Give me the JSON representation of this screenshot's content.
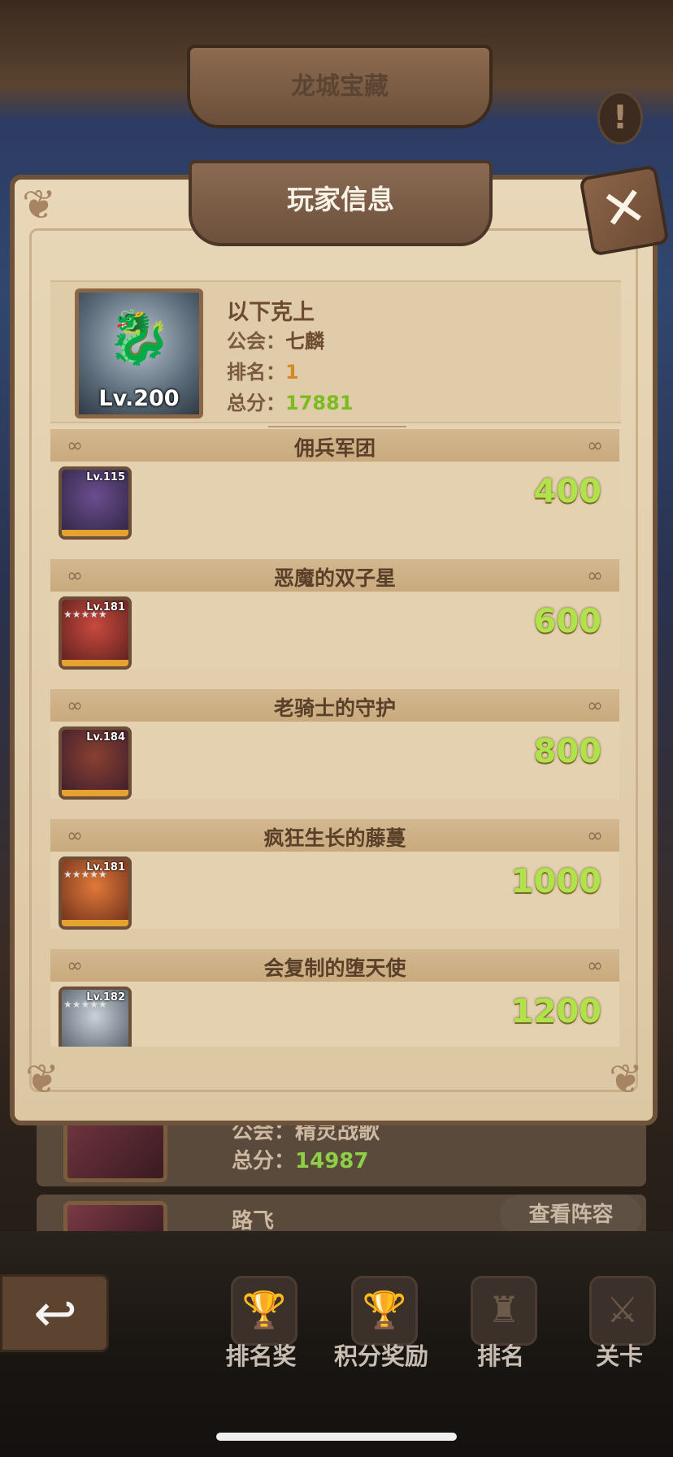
{
  "top_title": "龙城宝藏",
  "info_icon": "!",
  "modal": {
    "title": "玩家信息",
    "close_icon": "✕"
  },
  "player": {
    "level": "Lv.200",
    "name": "以下克上",
    "guild_label": "公会：",
    "guild_value": "七麟",
    "rank_label": "排名：",
    "rank_value": "1",
    "total_label": "总分：",
    "total_value": "17881"
  },
  "sections": [
    {
      "title": "佣兵军团",
      "hero_level": "Lv.115",
      "score": "400",
      "hero_colors": [
        "#6b4d8f",
        "#2d2540"
      ],
      "stars": ""
    },
    {
      "title": "恶魔的双子星",
      "hero_level": "Lv.181",
      "score": "600",
      "hero_colors": [
        "#c74a3d",
        "#5a1e1e"
      ],
      "stars": "★★★★★"
    },
    {
      "title": "老骑士的守护",
      "hero_level": "Lv.184",
      "score": "800",
      "hero_colors": [
        "#8a4030",
        "#3b1d2e"
      ],
      "stars": ""
    },
    {
      "title": "疯狂生长的藤蔓",
      "hero_level": "Lv.181",
      "score": "1000",
      "hero_colors": [
        "#e0793a",
        "#6a2d1a"
      ],
      "stars": "★★★★★"
    },
    {
      "title": "会复制的堕天使",
      "hero_level": "Lv.182",
      "score": "1200",
      "hero_colors": [
        "#c9d0d8",
        "#4b5561"
      ],
      "stars": "★★★★★"
    }
  ],
  "background_list": {
    "row1_guild": "公会：精灵战歌",
    "row1_total_label": "总分：",
    "row1_total_value": "14987",
    "row2_name": "路飞",
    "view_lineup_button": "查看阵容"
  },
  "bottom_nav": [
    {
      "label": "排名奖",
      "icon": "rank-reward-icon"
    },
    {
      "label": "积分奖励",
      "icon": "points-reward-icon"
    },
    {
      "label": "排名",
      "icon": "ranking-icon"
    },
    {
      "label": "关卡",
      "icon": "stage-icon"
    }
  ],
  "back_icon": "↩"
}
